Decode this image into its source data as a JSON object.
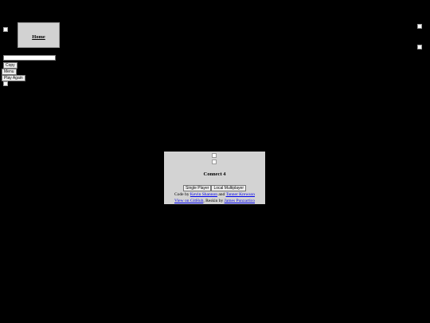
{
  "header": {
    "home_label": "Home",
    "logo_icon": "broken-image-icon",
    "right_icons": [
      "broken-image-icon",
      "broken-image-icon"
    ]
  },
  "controls": {
    "share_input_value": "",
    "copy_label": "Copy",
    "menu_label": "Menu",
    "play_again_label": "Play Again"
  },
  "game": {
    "title": "Connect 4",
    "single_player_label": "Single Player",
    "local_multiplayer_label": "Local Multiplayer"
  },
  "credits": {
    "code_by": "Code by",
    "author1": "Kevin Shannon",
    "and": "and",
    "author2": "Tanner Krewson",
    "github": "View on GitHub",
    "reskin_by": ", Reskin by",
    "reskinner": "James Punzartico"
  },
  "colors": {
    "background": "#000000",
    "panel": "#d3d3d3",
    "link": "#0000ee"
  }
}
